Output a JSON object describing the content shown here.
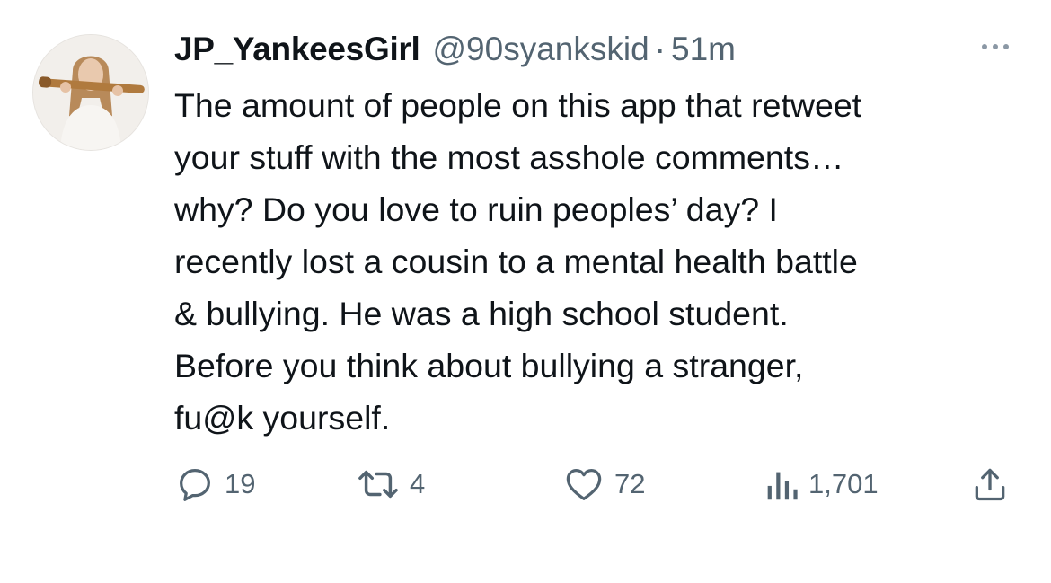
{
  "author": {
    "display_name": "JP_YankeesGirl",
    "handle": "@90syankskid",
    "separator": "·",
    "time": "51m"
  },
  "tweet": {
    "lines": [
      "The amount of people on this app that retweet",
      "your stuff with the most asshole comments…",
      "why? Do you love to ruin peoples’ day? I",
      "recently lost a cousin to a mental health battle",
      "& bullying. He was a high school student.",
      "Before you think about bullying a stranger,",
      "fu@k yourself."
    ]
  },
  "actions": {
    "replies": "19",
    "retweets": "4",
    "likes": "72",
    "views": "1,701"
  },
  "icons": {
    "more": "more-horizontal-icon",
    "reply": "reply-icon",
    "retweet": "retweet-icon",
    "like": "heart-icon",
    "views": "views-bar-chart-icon",
    "share": "share-icon"
  },
  "colors": {
    "text_primary": "#0f1419",
    "text_secondary": "#536471"
  }
}
